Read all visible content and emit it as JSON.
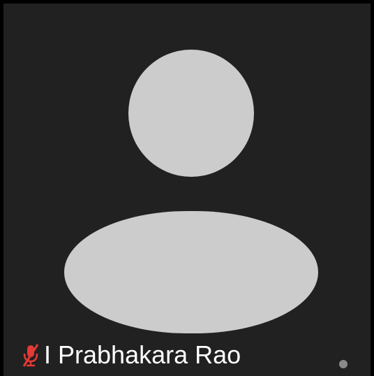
{
  "participant": {
    "name": "I Prabhakara Rao",
    "muted": true
  },
  "icons": {
    "mic": "mic-off-icon",
    "status": "status-dot"
  },
  "colors": {
    "tile_background": "#212121",
    "avatar": "#cccccc",
    "muted_icon": "#e53935",
    "name_text": "#ffffff"
  }
}
